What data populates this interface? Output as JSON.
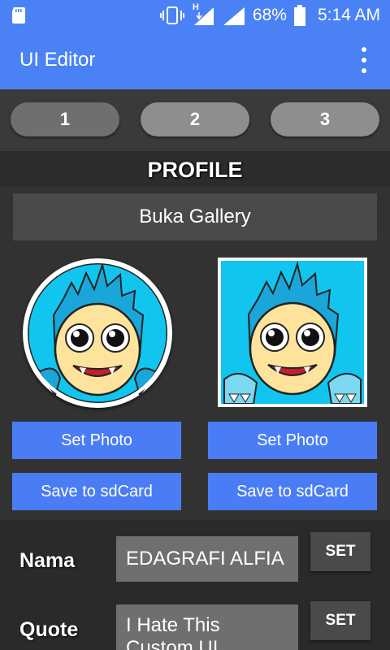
{
  "status_bar": {
    "network_type": "H",
    "battery_percent": "68%",
    "time": "5:14 AM"
  },
  "app_bar": {
    "title": "UI Editor"
  },
  "tabs": [
    {
      "label": "1"
    },
    {
      "label": "2"
    },
    {
      "label": "3"
    }
  ],
  "profile": {
    "title": "PROFILE",
    "open_gallery_label": "Buka Gallery",
    "left": {
      "set_photo_label": "Set Photo",
      "save_label": "Save to sdCard"
    },
    "right": {
      "set_photo_label": "Set Photo",
      "save_label": "Save to sdCard"
    }
  },
  "form": {
    "name_label": "Nama",
    "name_value": "EDAGRAFI ALFIA",
    "quote_label": "Quote",
    "quote_value": "I Hate This Custom UI",
    "set_label": "SET"
  },
  "colors": {
    "primary": "#4a82f5",
    "button_blue": "#4a7df5",
    "avatar_cyan": "#11c5ef"
  }
}
